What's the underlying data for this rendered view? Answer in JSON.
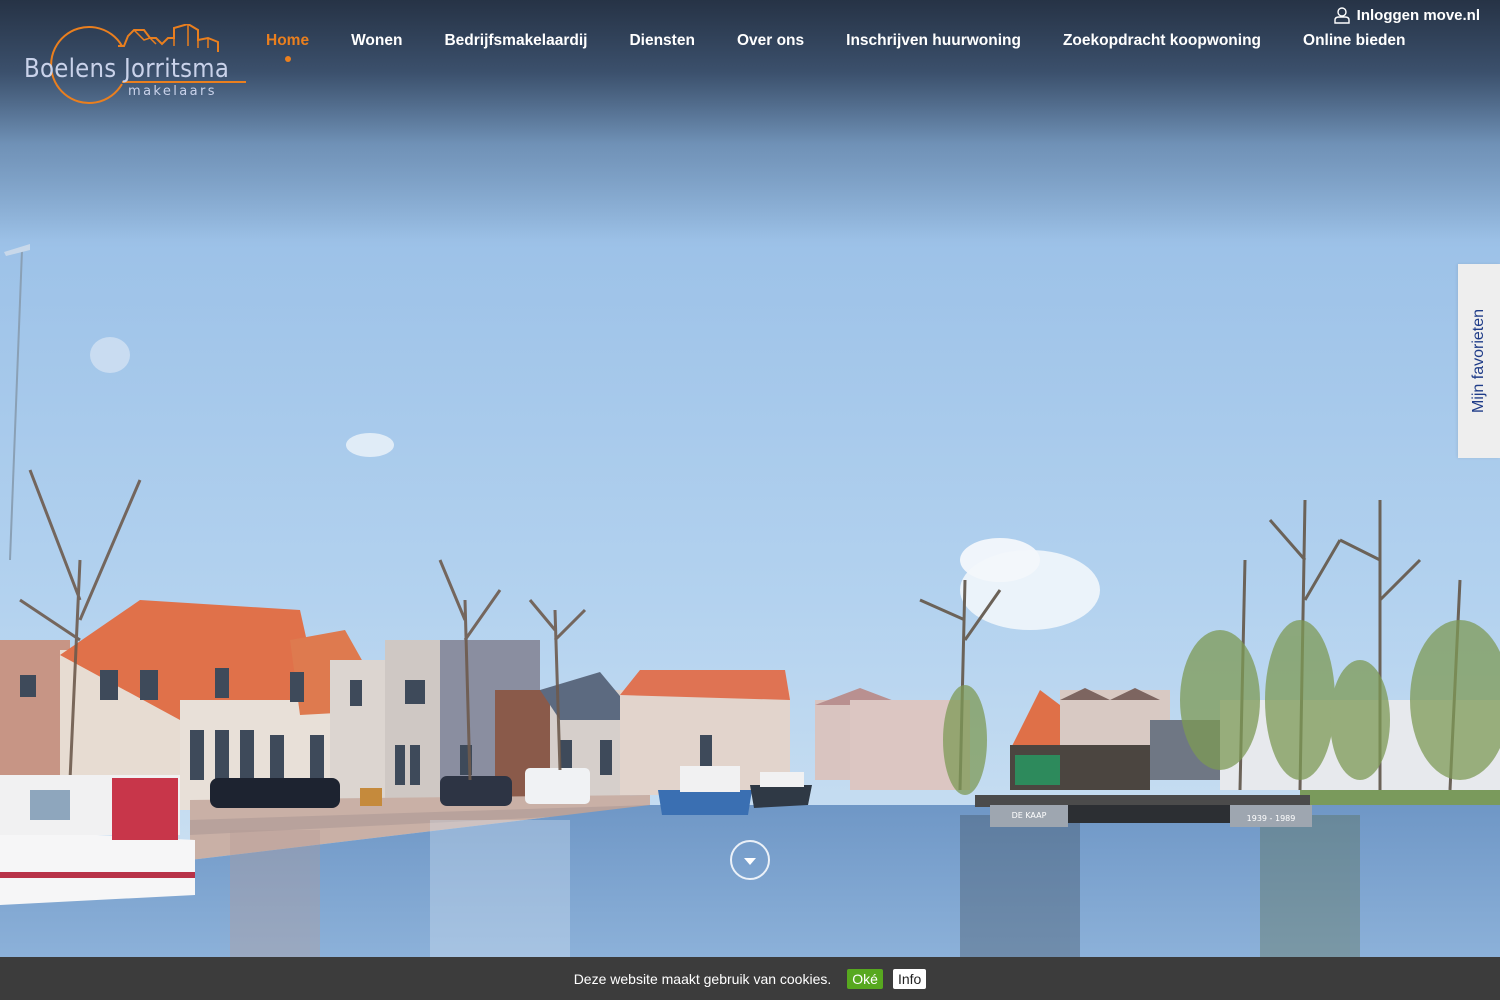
{
  "brand": {
    "name": "Boelens Jorritsma",
    "subtitle": "makelaars",
    "accent_color": "#ea7f1e",
    "text_color": "#c9d2ea"
  },
  "header": {
    "login": {
      "icon": "user-icon",
      "label": "Inloggen move.nl"
    },
    "nav": [
      {
        "label": "Home",
        "active": true
      },
      {
        "label": "Wonen",
        "active": false
      },
      {
        "label": "Bedrijfsmakelaardij",
        "active": false
      },
      {
        "label": "Diensten",
        "active": false
      },
      {
        "label": "Over ons",
        "active": false
      },
      {
        "label": "Inschrijven huurwoning",
        "active": false
      },
      {
        "label": "Zoekopdracht koopwoning",
        "active": false
      },
      {
        "label": "Online bieden",
        "active": false
      }
    ]
  },
  "hero": {
    "image_description": "Canal with houses, trees, moored boats and a jetty",
    "jetty_signs": [
      "DE KAAP",
      "1939 - 1989"
    ],
    "scroll_icon": "chevron-down-icon"
  },
  "favorites_tab": {
    "label": "Mijn favorieten",
    "color": "#1f3c88"
  },
  "cookie_bar": {
    "message": "Deze website maakt gebruik van cookies.",
    "ok_label": "Oké",
    "info_label": "Info",
    "ok_color": "#57a81f"
  }
}
